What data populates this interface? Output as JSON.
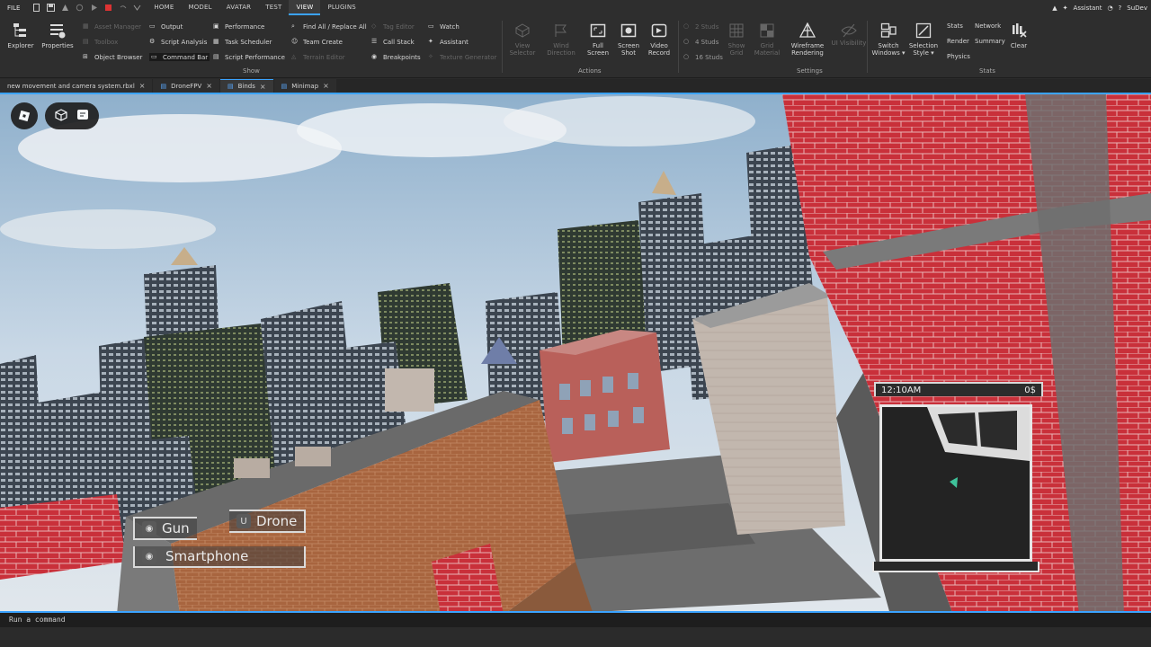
{
  "menubar": {
    "file": "FILE",
    "tabs": [
      "HOME",
      "MODEL",
      "AVATAR",
      "TEST",
      "VIEW",
      "PLUGINS"
    ],
    "active_tab": "VIEW",
    "assistant": "Assistant",
    "user": "SuDev"
  },
  "ribbon": {
    "explorer": "Explorer",
    "properties": "Properties",
    "asset_manager": "Asset Manager",
    "toolbox": "Toolbox",
    "object_browser": "Object Browser",
    "output": "Output",
    "script_analysis": "Script Analysis",
    "command_bar": "Command Bar",
    "performance": "Performance",
    "task_scheduler": "Task Scheduler",
    "script_performance": "Script Performance",
    "find_all": "Find All / Replace All",
    "team_create": "Team Create",
    "terrain_editor": "Terrain Editor",
    "tag_editor": "Tag Editor",
    "call_stack": "Call Stack",
    "breakpoints": "Breakpoints",
    "watch": "Watch",
    "assistant": "Assistant",
    "texture_generator": "Texture Generator",
    "show_label": "Show",
    "view_selector": [
      "View",
      "Selector"
    ],
    "wind_direction": [
      "Wind",
      "Direction"
    ],
    "full_screen": [
      "Full",
      "Screen"
    ],
    "screen_shot": [
      "Screen",
      "Shot"
    ],
    "video_record": [
      "Video",
      "Record"
    ],
    "actions_label": "Actions",
    "studs": [
      "2 Studs",
      "4 Studs",
      "16 Studs"
    ],
    "show_grid": [
      "Show",
      "Grid"
    ],
    "grid_material": [
      "Grid",
      "Material"
    ],
    "wireframe_rendering": [
      "Wireframe",
      "Rendering"
    ],
    "ui_visibility": "UI Visibility",
    "settings_label": "Settings",
    "switch_windows": [
      "Switch",
      "Windows ▾"
    ],
    "selection_style": [
      "Selection",
      "Style ▾"
    ],
    "stats": "Stats",
    "render": "Render",
    "physics": "Physics",
    "network": "Network",
    "summary": "Summary",
    "clear": "Clear",
    "stats_label": "Stats"
  },
  "doc_tabs": [
    {
      "label": "new movement and camera system.rbxl",
      "active": false
    },
    {
      "label": "DroneFPV",
      "active": false
    },
    {
      "label": "Binds",
      "active": true
    },
    {
      "label": "Minimap",
      "active": false
    }
  ],
  "hud": {
    "slot_gun": "Gun",
    "slot_drone_key": "U",
    "slot_drone": "Drone",
    "slot_smartphone": "Smartphone",
    "time": "12:10AM",
    "money": "0$"
  },
  "command": {
    "placeholder": "Run a command"
  },
  "colors": {
    "accent": "#3ba3ff",
    "brick": "#c8323a",
    "sky": "#a9c4dd"
  }
}
